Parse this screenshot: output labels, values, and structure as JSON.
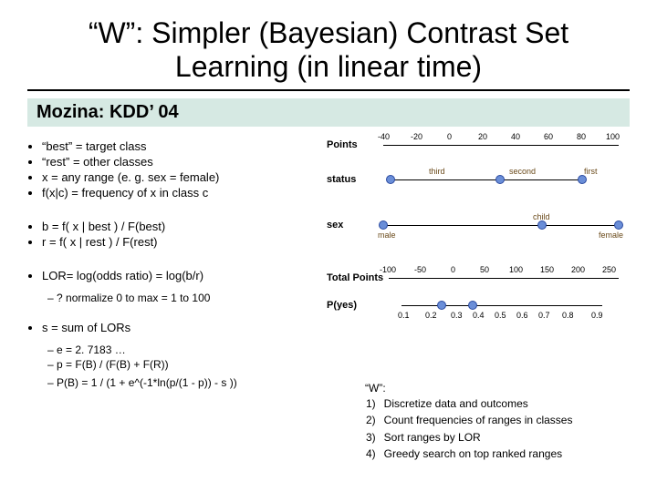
{
  "title": "“W”: Simpler (Bayesian) Contrast Set Learning (in linear time)",
  "subtitle": "Mozina: KDD’ 04",
  "defs": {
    "b1": "“best” = target class",
    "b2": "“rest” = other classes",
    "b3": "x = any range  (e. g. sex = female)",
    "b4": "f(x|c) = frequency of x  in class c"
  },
  "br": {
    "b": "b = f( x | best ) / F(best)",
    "r": "r  = f( x | rest )  / F(rest)"
  },
  "lor": {
    "line": "LOR= log(odds ratio) = log(b/r)",
    "sub": "? normalize 0 to max = 1 to 100"
  },
  "s": {
    "line": "s = sum of LORs",
    "e": "e       =  2. 7183 …",
    "p": "p       = F(B) / (F(B) + F(R))",
    "pb": "P(B) = 1 / (1 + e^(-1*ln(p/(1 - p)) - s ))"
  },
  "nomo": {
    "points": "Points",
    "status": "status",
    "sex": "sex",
    "total": "Total Points",
    "pyes": "P(yes)",
    "pts_ticks": [
      "-40",
      "-20",
      "0",
      "20",
      "40",
      "60",
      "80",
      "100"
    ],
    "status_vals": {
      "third": "third",
      "second": "second",
      "first": "first"
    },
    "sex_vals": {
      "male": "male",
      "child": "child",
      "female": "female"
    },
    "tot_ticks": [
      "-100",
      "-50",
      "0",
      "50",
      "100",
      "150",
      "200",
      "250"
    ],
    "py_ticks": [
      "0.1",
      "0.2",
      "0.3",
      "0.4",
      "0.5",
      "0.6",
      "0.7",
      "0.8",
      "0.9"
    ]
  },
  "wlist": {
    "head": "“W”:",
    "n1": "1)",
    "t1": "Discretize data and outcomes",
    "n2": "2)",
    "t2": "Count frequencies of ranges in classes",
    "n3": "3)",
    "t3": "Sort ranges by LOR",
    "n4": "4)",
    "t4": "Greedy search on top ranked ranges"
  }
}
